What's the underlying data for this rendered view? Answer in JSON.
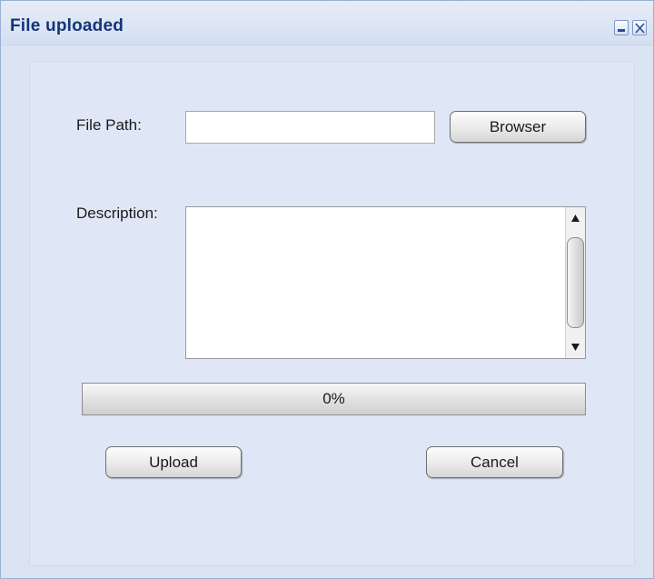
{
  "window": {
    "title": "File uploaded",
    "minimize_icon": "minimize-icon",
    "close_icon": "close-icon"
  },
  "form": {
    "file_path_label": "File Path:",
    "file_path_value": "",
    "browse_button": "Browser",
    "description_label": "Description:",
    "description_value": ""
  },
  "progress": {
    "text": "0%",
    "value": 0
  },
  "actions": {
    "upload_button": "Upload",
    "cancel_button": "Cancel"
  },
  "colors": {
    "title_text": "#14357a",
    "window_background": "#dbe4f3"
  }
}
